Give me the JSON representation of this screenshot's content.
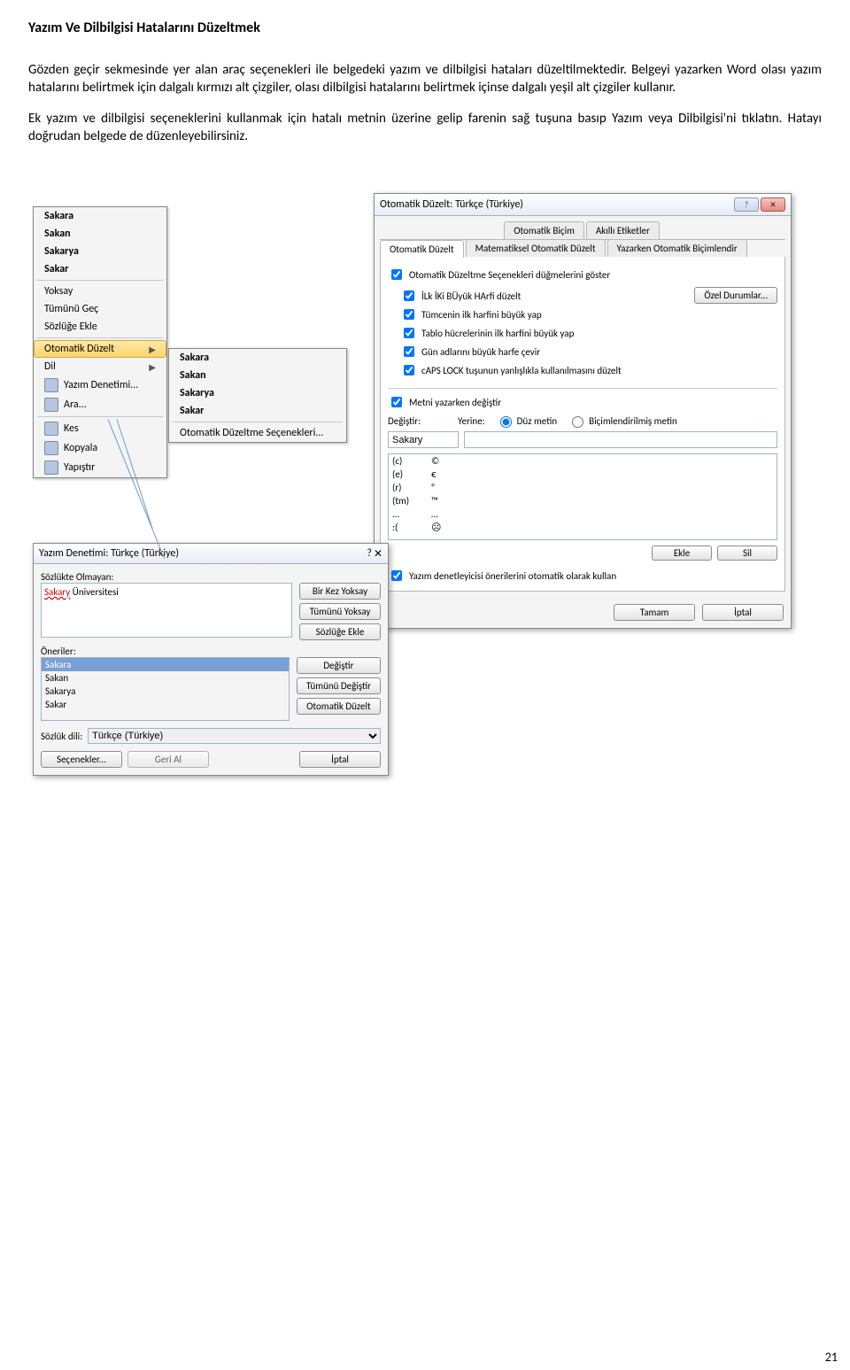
{
  "page": {
    "title": "Yazım Ve Dilbilgisi Hatalarını Düzeltmek",
    "para1": "Gözden geçir sekmesinde yer alan araç seçenekleri ile belgedeki yazım ve dilbilgisi hataları düzeltilmektedir. Belgeyi yazarken Word olası yazım hatalarını belirtmek için dalgalı kırmızı alt çizgiler, olası dilbilgisi hatalarını belirtmek içinse dalgalı yeşil alt çizgiler kullanır.",
    "para2": "Ek yazım ve dilbilgisi seçeneklerini kullanmak için hatalı metnin üzerine gelip farenin sağ tuşuna basıp Yazım veya Dilbilgisi'ni tıklatın. Hatayı doğrudan belgede de düzenleyebilirsiniz.",
    "number": "21"
  },
  "context_menu_1": {
    "s1": "Sakara",
    "s2": "Sakan",
    "s3": "Sakarya",
    "s4": "Sakar",
    "ignore": "Yoksay",
    "ignore_all": "Tümünü Geç",
    "add_dict": "Sözlüğe Ekle",
    "autocorrect": "Otomatik Düzelt",
    "language": "Dil",
    "spelling": "Yazım Denetimi...",
    "lookup": "Ara...",
    "cut": "Kes",
    "copy": "Kopyala",
    "paste": "Yapıştır"
  },
  "context_menu_2": {
    "s1": "Sakara",
    "s2": "Sakan",
    "s3": "Sakarya",
    "s4": "Sakar",
    "options": "Otomatik Düzeltme Seçenekleri..."
  },
  "autocorrect": {
    "title": "Otomatik Düzelt: Türkçe (Türkiye)",
    "tab_autoformat": "Otomatik Biçim",
    "tab_smarttags": "Akıllı Etiketler",
    "tab_autocorrect": "Otomatik Düzelt",
    "tab_math": "Matematiksel Otomatik Düzelt",
    "tab_aft": "Yazarken Otomatik Biçimlendir",
    "show_buttons": "Otomatik Düzeltme Seçenekleri düğmelerini göster",
    "c1": "İLk İKi BÜyük HArfi düzelt",
    "c2": "Tümcenin ilk harfini büyük yap",
    "c3": "Tablo hücrelerinin ilk harfini büyük yap",
    "c4": "Gün adlarını büyük harfe çevir",
    "c5": "cAPS LOCK tuşunun yanlışlıkla kullanılmasını düzelt",
    "exceptions": "Özel Durumlar...",
    "replace_as_type": "Metni yazarken değiştir",
    "replace": "Değiştir:",
    "with": "Yerine:",
    "plain": "Düz metin",
    "formatted": "Biçimlendirilmiş metin",
    "replace_value": "Sakary",
    "rows": {
      "r1a": "(c)",
      "r1b": "©",
      "r2a": "(e)",
      "r2b": "€",
      "r3a": "(r)",
      "r3b": "®",
      "r4a": "(tm)",
      "r4b": "™",
      "r5a": "...",
      "r5b": "…",
      "r6a": ":(",
      "r6b": "☹"
    },
    "add": "Ekle",
    "delete": "Sil",
    "use_suggestions": "Yazım denetleyicisi önerilerini otomatik olarak kullan",
    "ok": "Tamam",
    "cancel": "İptal"
  },
  "spellcheck": {
    "title": "Yazım Denetimi: Türkçe (Türkiye)",
    "not_in_dict": "Sözlükte Olmayan:",
    "text_pre": "Sakary",
    "text_after": " Üniversitesi",
    "suggestions_label": "Öneriler:",
    "sug1": "Sakara",
    "sug2": "Sakan",
    "sug3": "Sakarya",
    "sug4": "Sakar",
    "ignore_once": "Bir Kez Yoksay",
    "ignore_all": "Tümünü Yoksay",
    "add": "Sözlüğe Ekle",
    "change": "Değiştir",
    "change_all": "Tümünü Değiştir",
    "autocorrect": "Otomatik Düzelt",
    "dict_lang": "Sözlük dili:",
    "lang_value": "Türkçe (Türkiye)",
    "options": "Seçenekler...",
    "undo": "Geri Al",
    "cancel": "İptal"
  }
}
